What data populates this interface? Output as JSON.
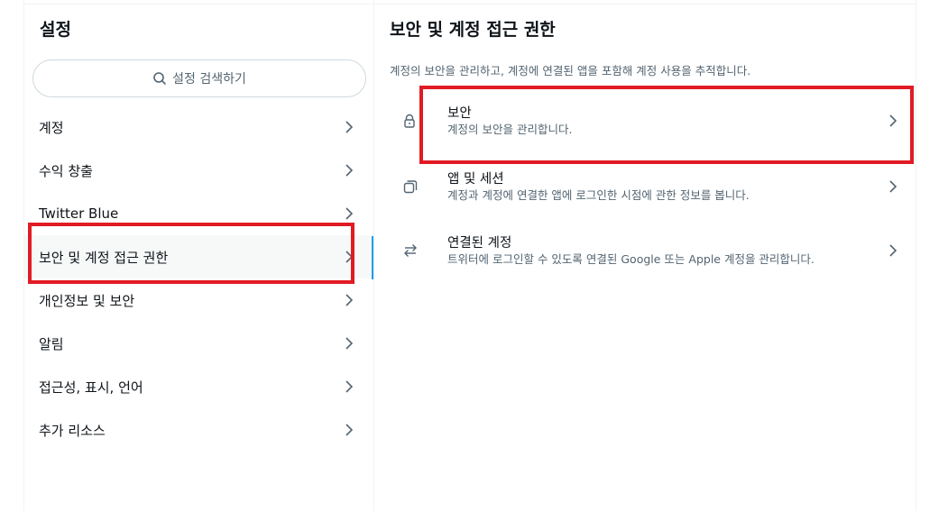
{
  "colors": {
    "accent": "#1d9bf0",
    "highlight": "#e11b24",
    "muted": "#536471",
    "text": "#0f1419"
  },
  "settings": {
    "title": "설정",
    "search_placeholder": "설정 검색하기",
    "items": [
      {
        "label": "계정"
      },
      {
        "label": "수익 창출"
      },
      {
        "label": "Twitter Blue"
      },
      {
        "label": "보안 및 계정 접근 권한",
        "active": true
      },
      {
        "label": "개인정보 및 보안"
      },
      {
        "label": "알림"
      },
      {
        "label": "접근성, 표시, 언어"
      },
      {
        "label": "추가 리소스"
      }
    ]
  },
  "detail": {
    "title": "보안 및 계정 접근 권한",
    "description": "계정의 보안을 관리하고, 계정에 연결된 앱을 포함해 계정 사용을 추적합니다.",
    "options": [
      {
        "title": "보안",
        "subtitle": "계정의 보안을 관리합니다.",
        "icon": "lock-icon"
      },
      {
        "title": "앱 및 세션",
        "subtitle": "계정과 계정에 연결한 앱에 로그인한 시점에 관한 정보를 봅니다.",
        "icon": "apps-icon"
      },
      {
        "title": "연결된 계정",
        "subtitle": "트위터에 로그인할 수 있도록 연결된 Google 또는 Apple 계정을 관리합니다.",
        "icon": "swap-arrows-icon"
      }
    ]
  }
}
